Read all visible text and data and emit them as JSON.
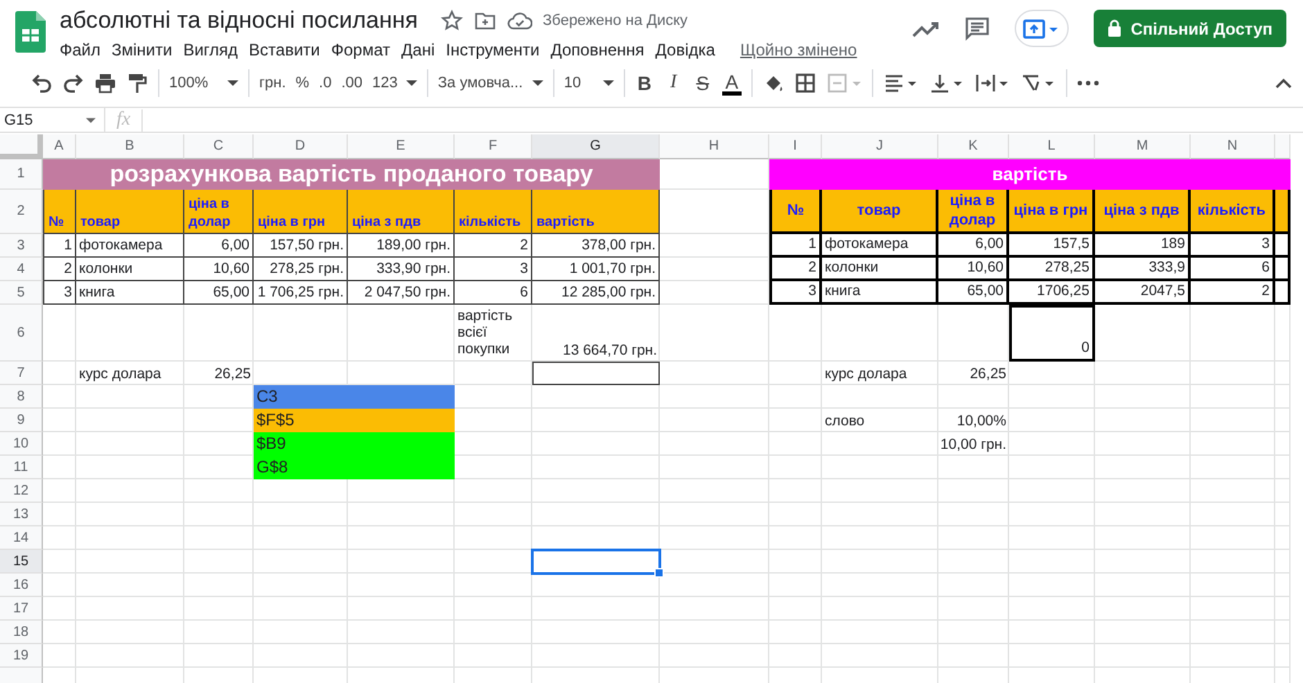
{
  "document": {
    "title": "абсолютні та відносні посилання",
    "save_status": "Збережено на Диску"
  },
  "menu": [
    "Файл",
    "Змінити",
    "Вигляд",
    "Вставити",
    "Формат",
    "Дані",
    "Інструменти",
    "Доповнення",
    "Довідка"
  ],
  "last_edit": "Щойно змінено",
  "share_button": "Спільний Доступ",
  "toolbar": {
    "zoom": "100%",
    "currency": "грн.",
    "percent": "%",
    "decrease_decimals": ".0",
    "increase_decimals": ".00",
    "number_format": "123",
    "font": "За умовча...",
    "font_size": "10",
    "bold": "B",
    "italic": "I",
    "strikethrough": "S",
    "text_color": "A"
  },
  "formula_bar": {
    "name_box": "G15",
    "fx": "fx"
  },
  "columns": [
    {
      "label": "A",
      "selected": false
    },
    {
      "label": "B",
      "selected": false
    },
    {
      "label": "C",
      "selected": false
    },
    {
      "label": "D",
      "selected": false
    },
    {
      "label": "E",
      "selected": false
    },
    {
      "label": "F",
      "selected": false
    },
    {
      "label": "G",
      "selected": true
    },
    {
      "label": "H",
      "selected": false
    },
    {
      "label": "I",
      "selected": false
    },
    {
      "label": "J",
      "selected": false
    },
    {
      "label": "K",
      "selected": false
    },
    {
      "label": "L",
      "selected": false
    },
    {
      "label": "M",
      "selected": false
    },
    {
      "label": "N",
      "selected": false
    }
  ],
  "rows": [
    {
      "label": "1",
      "selected": false
    },
    {
      "label": "2",
      "selected": false
    },
    {
      "label": "3",
      "selected": false
    },
    {
      "label": "4",
      "selected": false
    },
    {
      "label": "5",
      "selected": false
    },
    {
      "label": "6",
      "selected": false
    },
    {
      "label": "7",
      "selected": false
    },
    {
      "label": "8",
      "selected": false
    },
    {
      "label": "9",
      "selected": false
    },
    {
      "label": "10",
      "selected": false
    },
    {
      "label": "11",
      "selected": false
    },
    {
      "label": "12",
      "selected": false
    },
    {
      "label": "13",
      "selected": false
    },
    {
      "label": "14",
      "selected": false
    },
    {
      "label": "15",
      "selected": true
    },
    {
      "label": "16",
      "selected": false
    },
    {
      "label": "17",
      "selected": false
    },
    {
      "label": "18",
      "selected": false
    },
    {
      "label": "19",
      "selected": false
    }
  ],
  "left_table": {
    "title": "розрахункова вартість проданого товару",
    "headers": [
      "№",
      "товар",
      "ціна в долар",
      "ціна в грн",
      "ціна з пдв",
      "кількість",
      "вартість"
    ],
    "rows": [
      [
        "1",
        "фотокамера",
        "6,00",
        "157,50 грн.",
        "189,00 грн.",
        "2",
        "378,00 грн."
      ],
      [
        "2",
        "колонки",
        "10,60",
        "278,25 грн.",
        "333,90 грн.",
        "3",
        "1 001,70 грн."
      ],
      [
        "3",
        "книга",
        "65,00",
        "1 706,25 грн.",
        "2 047,50 грн.",
        "6",
        "12 285,00 грн."
      ]
    ],
    "total_label": "вартість всієї покупки",
    "total_value": "13 664,70 грн.",
    "rate_label": "курс долара",
    "rate_value": "26,25"
  },
  "references": [
    {
      "text": "C3",
      "color": "#4a86e8"
    },
    {
      "text": "$F$5",
      "color": "#fbbc04"
    },
    {
      "text": "$B9",
      "color": "#00ff00"
    },
    {
      "text": "G$8",
      "color": "#00ff00"
    }
  ],
  "right_table": {
    "title": "вартість",
    "headers": [
      "№",
      "товар",
      "ціна в долар",
      "ціна в грн",
      "ціна з пдв",
      "кількість"
    ],
    "rows": [
      [
        "1",
        "фотокамера",
        "6,00",
        "157,5",
        "189",
        "3"
      ],
      [
        "2",
        "колонки",
        "10,60",
        "278,25",
        "333,9",
        "6"
      ],
      [
        "3",
        "книга",
        "65,00",
        "1706,25",
        "2047,5",
        "2"
      ]
    ],
    "result": "0",
    "rate_label": "курс долара",
    "rate_value": "26,25",
    "word_label": "слово",
    "word_percent": "10,00%",
    "word_amount": "10,00 грн."
  }
}
